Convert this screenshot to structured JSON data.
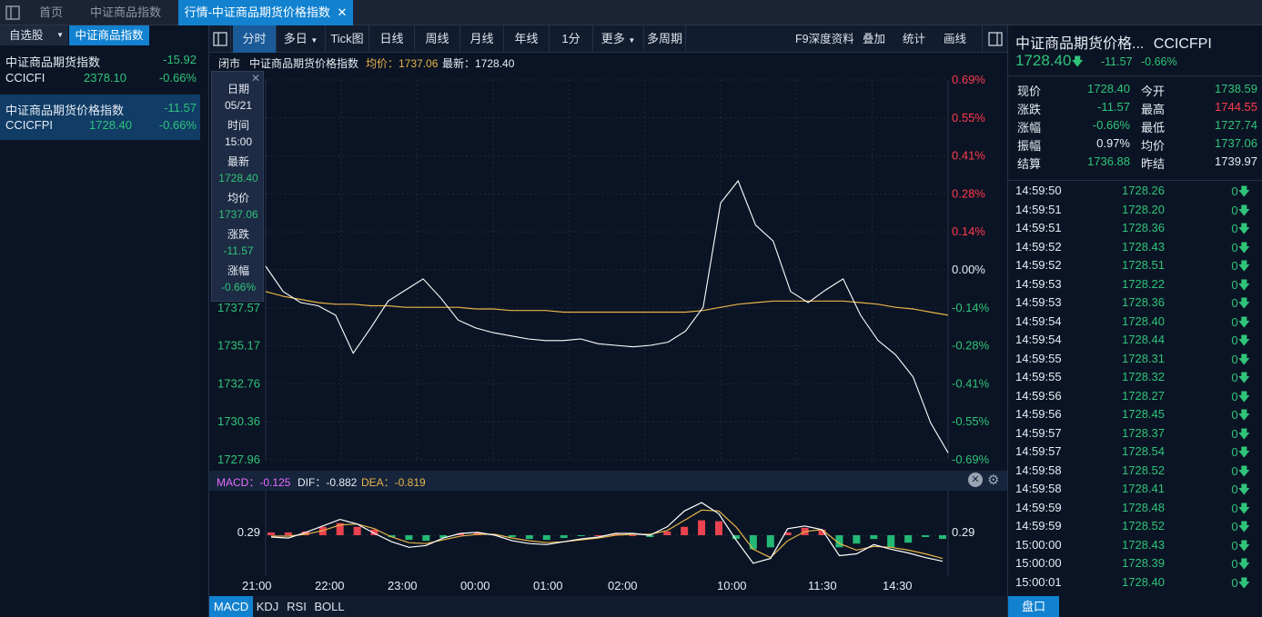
{
  "top_tabs": {
    "home": "首页",
    "csi": "中证商品指数",
    "active": "行情-中证商品期货价格指数"
  },
  "left": {
    "tab_watchlist": "自选股",
    "tab_csi": "中证商品指数",
    "items": [
      {
        "name": "中证商品期货指数",
        "change": "-15.92",
        "code": "CCICFI",
        "price": "2378.10",
        "pct": "-0.66%"
      },
      {
        "name": "中证商品期货价格指数",
        "change": "-11.57",
        "code": "CCICFPI",
        "price": "1728.40",
        "pct": "-0.66%"
      }
    ]
  },
  "toolbar": {
    "intraday": "分时",
    "multiday": "多日",
    "tick": "Tick图",
    "daily": "日线",
    "weekly": "周线",
    "monthly": "月线",
    "yearly": "年线",
    "min1": "1分",
    "more": "更多",
    "multiperiod": "多周期",
    "f9": "F9深度资料",
    "overlay": "叠加",
    "stats": "统计",
    "draw": "画线"
  },
  "info": {
    "status": "闭市",
    "name": "中证商品期货价格指数",
    "avg_label": "均价：1737.06",
    "last_label": "最新：1728.40"
  },
  "tooltip": {
    "date_label": "日期",
    "date": "05/21",
    "time_label": "时间",
    "time": "15:00",
    "last_label": "最新",
    "last": "1728.40",
    "avg_label": "均价",
    "avg": "1737.06",
    "chg_label": "涨跌",
    "chg": "-11.57",
    "pct_label": "涨幅",
    "pct": "-0.66%"
  },
  "macd": {
    "macd_label": "MACD：-0.125",
    "dif_label": "DIF：-0.882",
    "dea_label": "DEA：-0.819",
    "level_left": "0.29",
    "level_right": "0.29"
  },
  "bottom_tabs": [
    "MACD",
    "KDJ",
    "RSI",
    "BOLL"
  ],
  "right": {
    "title": "中证商品期货价格...",
    "code": "CCICFPI",
    "price": "1728.40",
    "change": "-11.57",
    "pct": "-0.66%",
    "quote": [
      {
        "l1": "现价",
        "v1": "1728.40",
        "c1": "green",
        "l2": "今开",
        "v2": "1738.59",
        "c2": "green"
      },
      {
        "l1": "涨跌",
        "v1": "-11.57",
        "c1": "green",
        "l2": "最高",
        "v2": "1744.55",
        "c2": "red"
      },
      {
        "l1": "涨幅",
        "v1": "-0.66%",
        "c1": "green",
        "l2": "最低",
        "v2": "1727.74",
        "c2": "green"
      },
      {
        "l1": "振幅",
        "v1": "0.97%",
        "c1": "white",
        "l2": "均价",
        "v2": "1737.06",
        "c2": "green"
      },
      {
        "l1": "结算",
        "v1": "1736.88",
        "c1": "green",
        "l2": "昨结",
        "v2": "1739.97",
        "c2": "white"
      }
    ],
    "ticks": [
      [
        "14:59:50",
        "1728.26",
        "0"
      ],
      [
        "14:59:51",
        "1728.20",
        "0"
      ],
      [
        "14:59:51",
        "1728.36",
        "0"
      ],
      [
        "14:59:52",
        "1728.43",
        "0"
      ],
      [
        "14:59:52",
        "1728.51",
        "0"
      ],
      [
        "14:59:53",
        "1728.22",
        "0"
      ],
      [
        "14:59:53",
        "1728.36",
        "0"
      ],
      [
        "14:59:54",
        "1728.40",
        "0"
      ],
      [
        "14:59:54",
        "1728.44",
        "0"
      ],
      [
        "14:59:55",
        "1728.31",
        "0"
      ],
      [
        "14:59:55",
        "1728.32",
        "0"
      ],
      [
        "14:59:56",
        "1728.27",
        "0"
      ],
      [
        "14:59:56",
        "1728.45",
        "0"
      ],
      [
        "14:59:57",
        "1728.37",
        "0"
      ],
      [
        "14:59:57",
        "1728.54",
        "0"
      ],
      [
        "14:59:58",
        "1728.52",
        "0"
      ],
      [
        "14:59:58",
        "1728.41",
        "0"
      ],
      [
        "14:59:59",
        "1728.48",
        "0"
      ],
      [
        "14:59:59",
        "1728.52",
        "0"
      ],
      [
        "15:00:00",
        "1728.43",
        "0"
      ],
      [
        "15:00:00",
        "1728.39",
        "0"
      ],
      [
        "15:00:01",
        "1728.40",
        "0"
      ]
    ],
    "bottom_btn": "盘口"
  },
  "colors": {
    "up": "#ff3b4f",
    "down": "#2fc47a",
    "avg_line": "#e8b449",
    "price_line": "#ffffff",
    "accent": "#1282d0"
  },
  "chart_data": {
    "type": "line",
    "title": "",
    "y_ticks": [
      "1737.57",
      "1735.17",
      "1732.76",
      "1730.36",
      "1727.96"
    ],
    "pct_ticks": [
      "0.69%",
      "0.55%",
      "0.41%",
      "0.28%",
      "0.14%",
      "0.00%",
      "-0.14%",
      "-0.28%",
      "-0.41%",
      "-0.55%",
      "-0.69%"
    ],
    "x_ticks": [
      "21:00",
      "22:00",
      "23:00",
      "00:00",
      "01:00",
      "02:00",
      "10:00",
      "11:30",
      "14:30"
    ],
    "prev_settle": 1739.97,
    "ylim": [
      1727.96,
      1751.98
    ],
    "series": [
      {
        "values": [
          1740.2,
          1738.6,
          1737.9,
          1737.7,
          1737.1,
          1734.7,
          1736.3,
          1738.0,
          1738.7,
          1739.4,
          1738.2,
          1736.8,
          1736.3,
          1736.0,
          1735.8,
          1735.6,
          1735.5,
          1735.5,
          1735.6,
          1735.3,
          1735.2,
          1735.1,
          1735.2,
          1735.4,
          1736.1,
          1737.6,
          1744.2,
          1745.6,
          1742.8,
          1741.8,
          1738.6,
          1737.9,
          1738.7,
          1739.4,
          1737.1,
          1735.5,
          1734.6,
          1733.2,
          1730.3,
          1728.4
        ]
      },
      {
        "values": [
          1738.6,
          1738.3,
          1738.1,
          1737.9,
          1737.8,
          1737.8,
          1737.7,
          1737.7,
          1737.6,
          1737.6,
          1737.6,
          1737.6,
          1737.5,
          1737.5,
          1737.4,
          1737.4,
          1737.4,
          1737.3,
          1737.3,
          1737.3,
          1737.3,
          1737.3,
          1737.3,
          1737.3,
          1737.3,
          1737.4,
          1737.6,
          1737.8,
          1737.9,
          1738.0,
          1738.0,
          1738.0,
          1738.0,
          1738.0,
          1737.9,
          1737.8,
          1737.6,
          1737.5,
          1737.3,
          1737.1
        ]
      }
    ],
    "macd_hist": [
      0.3,
      0.3,
      0.4,
      0.9,
      1.3,
      0.9,
      0.6,
      -0.2,
      -0.5,
      -0.6,
      -0.3,
      0.2,
      0.3,
      0.1,
      -0.2,
      -0.4,
      -0.5,
      -0.3,
      -0.1,
      0.0,
      0.2,
      0.0,
      -0.2,
      0.4,
      0.9,
      1.6,
      1.5,
      -0.4,
      -1.5,
      -1.3,
      0.3,
      0.8,
      0.6,
      -1.3,
      -0.9,
      -0.4,
      -1.3,
      -0.8,
      -0.2,
      -0.4
    ],
    "dif": [
      -0.2,
      -0.3,
      0.3,
      1.0,
      1.7,
      1.2,
      0.2,
      -0.7,
      -1.3,
      -1.1,
      -0.3,
      0.2,
      0.3,
      0.0,
      -0.6,
      -0.9,
      -1.0,
      -0.7,
      -0.4,
      -0.2,
      0.2,
      0.2,
      0.0,
      0.9,
      2.6,
      3.5,
      2.3,
      -0.5,
      -3.0,
      -2.5,
      0.7,
      1.0,
      0.6,
      -2.2,
      -2.0,
      -1.0,
      -1.5,
      -1.9,
      -2.4,
      -2.8
    ],
    "dea": [
      -0.1,
      -0.1,
      0.1,
      0.5,
      1.1,
      1.2,
      0.7,
      -0.2,
      -0.8,
      -0.9,
      -0.5,
      -0.1,
      0.1,
      0.1,
      -0.3,
      -0.6,
      -0.8,
      -0.7,
      -0.5,
      -0.3,
      0.0,
      0.1,
      0.1,
      0.5,
      1.6,
      2.7,
      2.6,
      0.9,
      -1.5,
      -2.4,
      -0.6,
      0.4,
      0.6,
      -0.9,
      -1.6,
      -1.2,
      -1.3,
      -1.6,
      -2.0,
      -2.5
    ]
  }
}
